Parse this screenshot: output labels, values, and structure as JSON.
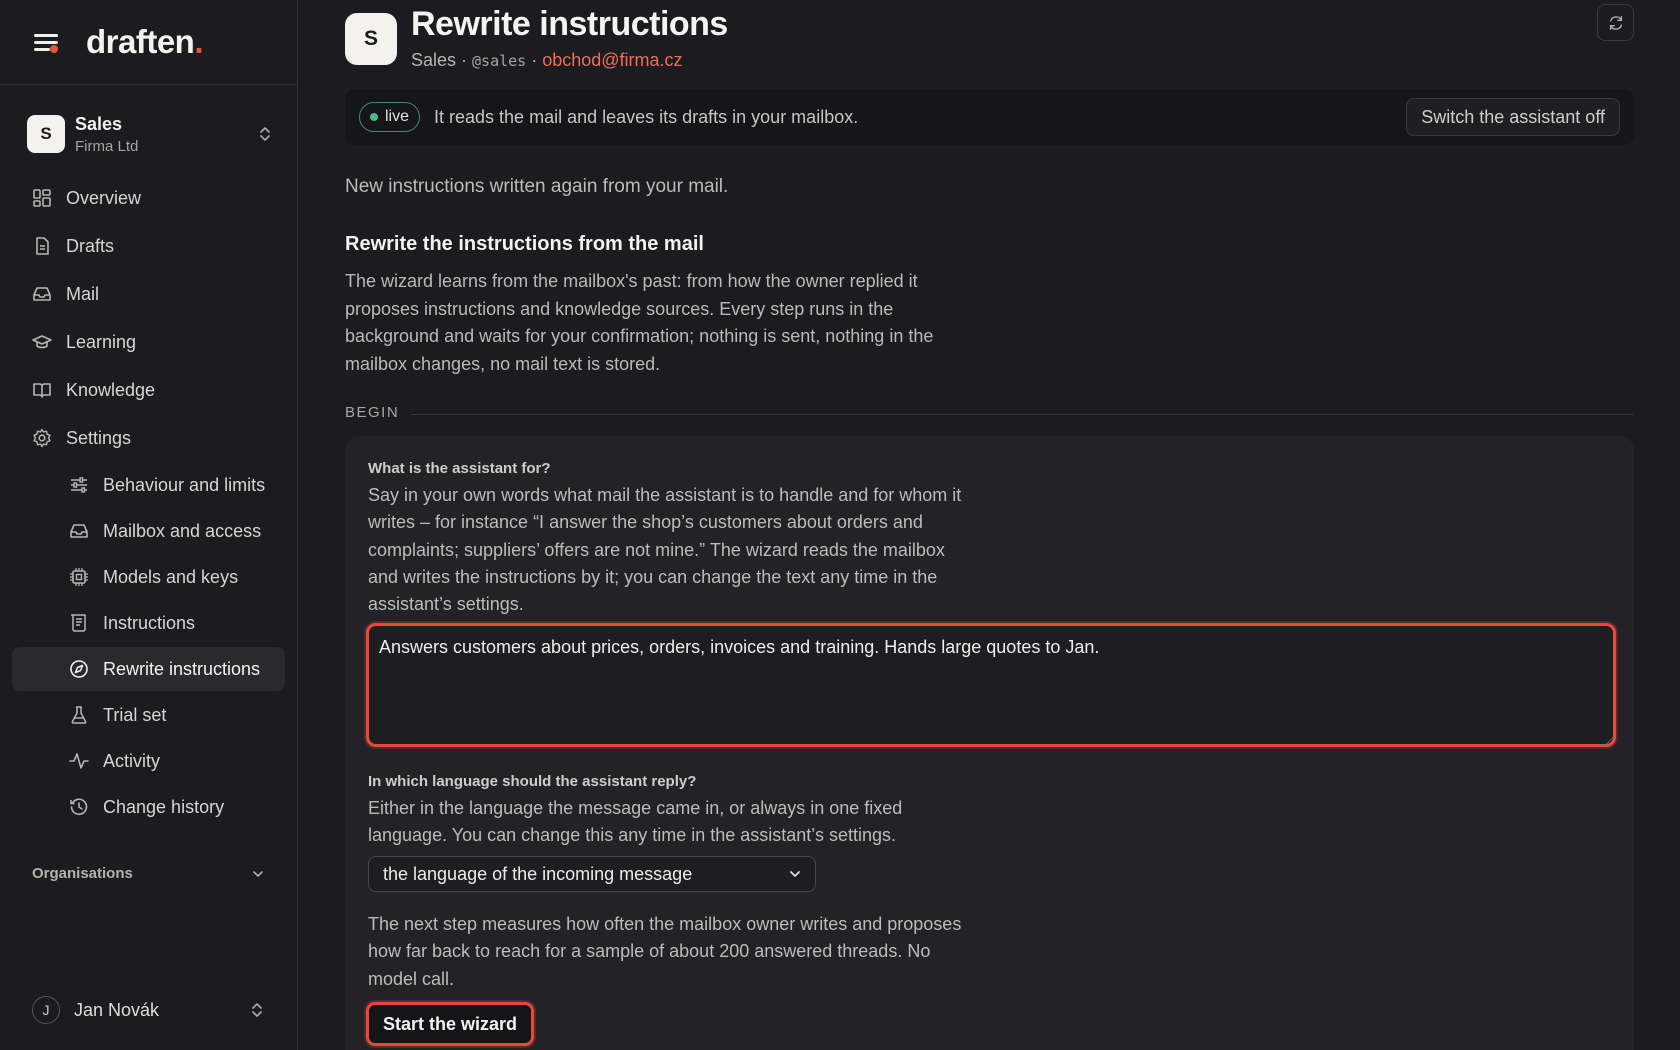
{
  "brand": {
    "name": "draften",
    "dot": "."
  },
  "workspace": {
    "avatar": "S",
    "name": "Sales",
    "org": "Firma Ltd"
  },
  "nav": {
    "overview": "Overview",
    "drafts": "Drafts",
    "mail": "Mail",
    "learning": "Learning",
    "knowledge": "Knowledge",
    "settings": "Settings",
    "sub": {
      "behaviour": "Behaviour and limits",
      "mailbox": "Mailbox and access",
      "models": "Models and keys",
      "instructions": "Instructions",
      "rewrite": "Rewrite instructions",
      "trial": "Trial set",
      "activity": "Activity",
      "history": "Change history"
    }
  },
  "orgs_label": "Organisations",
  "user": {
    "initial": "J",
    "name": "Jan Novák"
  },
  "header": {
    "avatar": "S",
    "title": "Rewrite instructions",
    "team": "Sales · ",
    "handle": "@sales",
    "sep": " · ",
    "email": "obchod@firma.cz"
  },
  "status": {
    "badge": "live",
    "text": "It reads the mail and leaves its drafts in your mailbox.",
    "off_button": "Switch the assistant off"
  },
  "intro": "New instructions written again from your mail.",
  "section": {
    "title": "Rewrite the instructions from the mail",
    "description": "The wizard learns from the mailbox's past: from how the owner replied it proposes instructions and knowledge sources. Every step runs in the background and waits for your confirmation; nothing is sent, nothing in the mailbox changes, no mail text is stored."
  },
  "begin_label": "BEGIN",
  "form": {
    "purpose_label": "What is the assistant for?",
    "purpose_help": "Say in your own words what mail the assistant is to handle and for whom it writes – for instance “I answer the shop’s customers about orders and complaints; suppliers’ offers are not mine.” The wizard reads the mailbox and writes the instructions by it; you can change the text any time in the assistant’s settings.",
    "purpose_value": "Answers customers about prices, orders, invoices and training. Hands large quotes to Jan.",
    "language_label": "In which language should the assistant reply?",
    "language_help": "Either in the language the message came in, or always in one fixed language. You can change this any time in the assistant’s settings.",
    "language_value": "the language of the incoming message",
    "next_step_note": "The next step measures how often the mailbox owner writes and proposes how far back to reach for a sample of about 200 answered threads. No model call.",
    "start_button": "Start the wizard"
  },
  "colors": {
    "accent": "#e5533d",
    "live": "#3fbf83",
    "email": "#ee6d56"
  }
}
